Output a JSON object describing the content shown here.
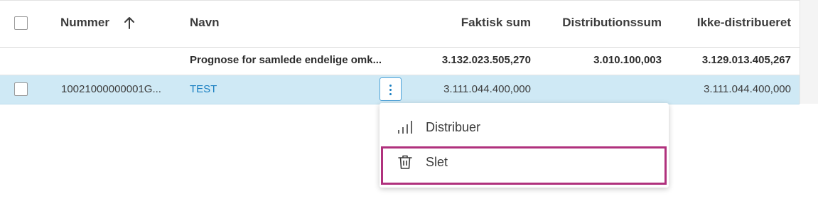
{
  "table": {
    "columns": {
      "number": "Nummer",
      "name": "Navn",
      "actual_sum": "Faktisk sum",
      "distribution_sum": "Distributionssum",
      "undistributed": "Ikke-distribueret"
    },
    "sort": {
      "column": "number",
      "direction": "ascending"
    },
    "summary_row": {
      "name": "Prognose for samlede endelige omk...",
      "actual_sum": "3.132.023.505,270",
      "distribution_sum": "3.010.100,003",
      "undistributed": "3.129.013.405,267"
    },
    "rows": [
      {
        "number": "10021000000001G...",
        "name": "TEST",
        "actual_sum": "3.111.044.400,000",
        "distribution_sum": "",
        "undistributed": "3.111.044.400,000",
        "selected": true
      }
    ]
  },
  "context_menu": {
    "items": [
      {
        "label": "Distribuer",
        "icon": "distribute-bars-icon"
      },
      {
        "label": "Slet",
        "icon": "trash-icon",
        "highlighted": true
      }
    ]
  },
  "colors": {
    "selected_row": "#cfe9f5",
    "link": "#1a7fc1",
    "highlight_border": "#b0317d"
  }
}
